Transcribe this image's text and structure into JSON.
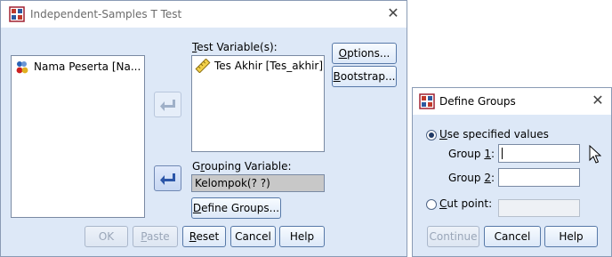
{
  "ttest": {
    "title": "Independent-Samples T Test",
    "source_items": [
      "Nama Peserta [Na..."
    ],
    "test_var_label": "Test Variable(s):",
    "test_var_label_u": "T",
    "test_var_label_rest": "est Variable(s):",
    "test_items": [
      "Tes  Akhir [Tes_akhir]"
    ],
    "grouping_label_pre": "G",
    "grouping_label_u": "r",
    "grouping_label_rest": "ouping Variable:",
    "grouping_value": "Kelompok(? ?)",
    "define_groups_u": "D",
    "define_groups_rest": "efine Groups...",
    "options_u": "O",
    "options_rest": "ptions...",
    "bootstrap_u": "B",
    "bootstrap_rest": "ootstrap...",
    "ok_label": "OK",
    "paste_u": "P",
    "paste_rest": "aste",
    "reset_u": "R",
    "reset_rest": "eset",
    "cancel_label": "Cancel",
    "help_label": "Help"
  },
  "define": {
    "title": "Define Groups",
    "use_specified_u": "U",
    "use_specified_rest": "se specified values",
    "group1_pre": "Group ",
    "group1_u": "1",
    "group1_post": ":",
    "group2_pre": "Group ",
    "group2_u": "2",
    "group2_post": ":",
    "cut_point_u": "C",
    "cut_point_rest": "ut point:",
    "continue_label": "Continue",
    "cancel_label": "Cancel",
    "help_label": "Help",
    "group1_value": "",
    "group2_value": ""
  },
  "icons": {
    "app": "spss-app-icon",
    "nominal_var": "nominal-variable-icon",
    "scale_var": "ruler-scale-variable-icon",
    "move": "arrow-move-icon",
    "close": "close-icon",
    "cursor": "mouse-pointer-icon"
  }
}
